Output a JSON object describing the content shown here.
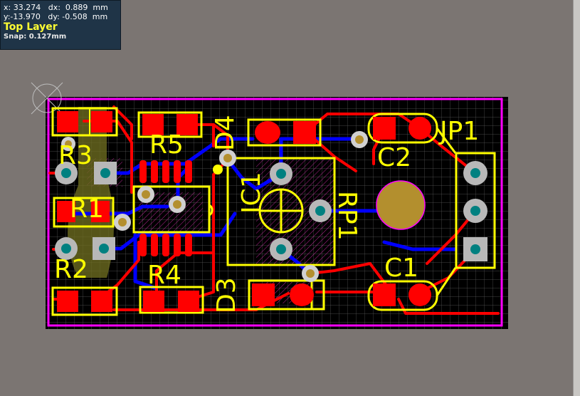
{
  "hud": {
    "x_label": "x:",
    "x_value": "33.274",
    "dx_label": "dx:",
    "dx_value": "0.889",
    "y_label": "y:",
    "y_value": "-13.970",
    "dy_label": "dy:",
    "dy_value": "-0.508",
    "unit": "mm",
    "layer": "Top Layer",
    "snap": "Snap: 0.127mm"
  },
  "components": {
    "r3": "R3",
    "r5": "R5",
    "r1": "R1",
    "r2": "R2",
    "r4": "R4",
    "d4": "D4",
    "d3": "D3",
    "ic1": "IC1",
    "rp1": "RP1",
    "c2": "C2",
    "c1": "C1",
    "jp1": "JP1"
  },
  "colors": {
    "board_bg": "#000000",
    "pad": "#ff0000",
    "top_trace": "#ff0000",
    "bottom_trace": "#0000ff",
    "silkscreen": "#ffff00",
    "outline": "#ff00ff",
    "via": "#b38f2e",
    "through_hole": "#b8b8b8",
    "through_hole_center": "#008080"
  }
}
